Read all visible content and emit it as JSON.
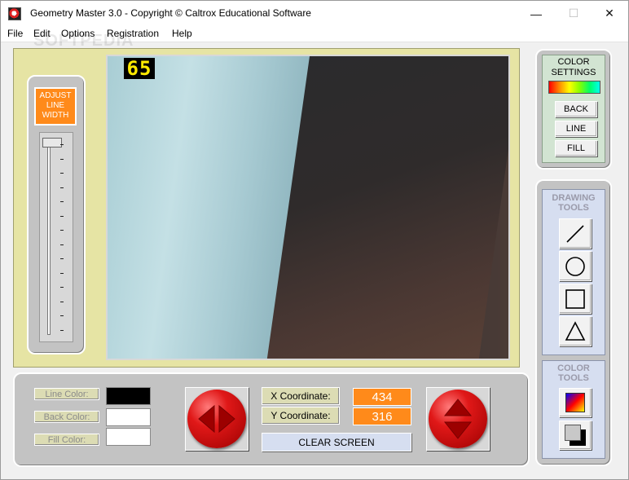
{
  "window": {
    "title": "Geometry Master 3.0   -   Copyright © Caltrox Educational Software",
    "minimize": "—",
    "maximize": "☐",
    "close": "✕"
  },
  "menu": [
    "File",
    "Edit",
    "Options",
    "Registration",
    "Help"
  ],
  "watermark": "SOFTPEDIA",
  "counter": "65",
  "line_width": {
    "label": "ADJUST LINE WIDTH",
    "value": 1
  },
  "color_settings": {
    "title": "COLOR SETTINGS",
    "back": "BACK",
    "line": "LINE",
    "fill": "FILL"
  },
  "drawing_tools": {
    "title": "DRAWING TOOLS",
    "tools": [
      "line-tool-icon",
      "circle-tool-icon",
      "square-tool-icon",
      "triangle-tool-icon"
    ]
  },
  "color_tools": {
    "title": "COLOR TOOLS"
  },
  "colors": {
    "line": "#000000",
    "back": "#ffffff",
    "fill": "#ffffff",
    "accent": "#ff8a1a"
  },
  "labels": {
    "line_color": "Line Color:",
    "back_color": "Back Color:",
    "fill_color": "Fill Color:"
  },
  "coords": {
    "x_label": "X Coordinate:",
    "y_label": "Y Coordinate:",
    "x": "434",
    "y": "316"
  },
  "clear_screen": "CLEAR SCREEN"
}
